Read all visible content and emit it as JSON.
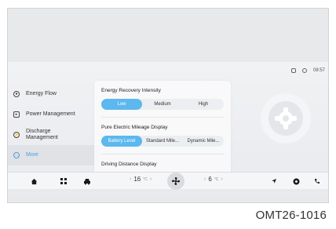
{
  "document_code": "OMT26-1016",
  "status_bar": {
    "time": "08:57"
  },
  "sidebar": {
    "items": [
      {
        "label": "Energy Flow",
        "icon": "energy-flow-icon"
      },
      {
        "label": "Power Management",
        "icon": "power-icon"
      },
      {
        "label": "Discharge Management",
        "icon": "discharge-icon"
      },
      {
        "label": "More",
        "icon": "more-icon",
        "active": true
      }
    ]
  },
  "panel": {
    "energy_recovery": {
      "title": "Energy Recovery Intensity",
      "options": [
        "Low",
        "Medium",
        "High"
      ],
      "selected": "Low"
    },
    "mileage_display": {
      "title": "Pure Electric Mileage Display",
      "options": [
        "Battery Level",
        "Standard Mile...",
        "Dynamic Mile..."
      ],
      "selected": "Battery Level"
    },
    "driving_distance": {
      "title": "Driving Distance Display"
    }
  },
  "dock": {
    "left_temp": "16",
    "right_temp": "6",
    "temp_unit": "°C",
    "icons": [
      "home-icon",
      "apps-grid-icon",
      "car-icon",
      "fan-icon",
      "navigation-icon",
      "music-icon",
      "phone-icon"
    ]
  },
  "colors": {
    "accent": "#5cb8ee",
    "active_text": "#4a9ee0"
  }
}
